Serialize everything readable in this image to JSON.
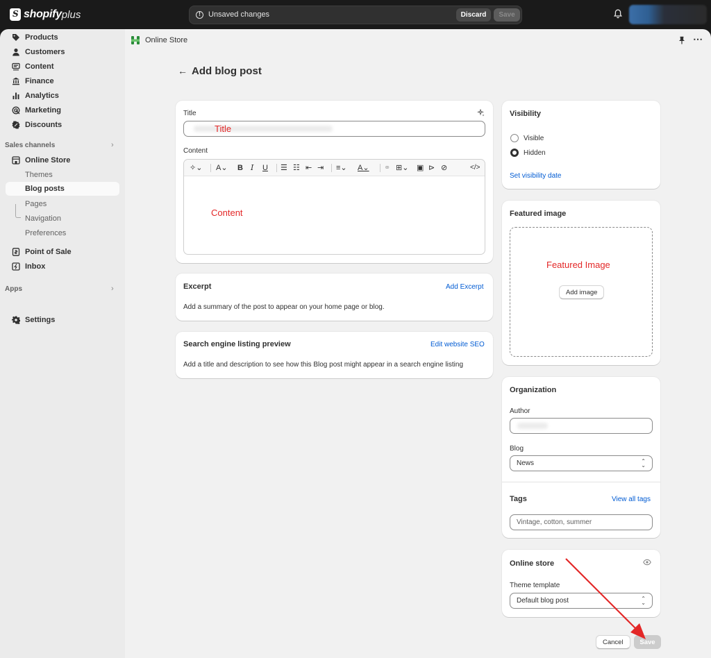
{
  "topbar": {
    "logo_text": "shopify",
    "logo_plus": "plus",
    "unsaved_text": "Unsaved changes",
    "discard_label": "Discard",
    "save_label": "Save"
  },
  "sidebar": {
    "items": [
      {
        "label": "Products",
        "icon": "tag-icon"
      },
      {
        "label": "Customers",
        "icon": "person-icon"
      },
      {
        "label": "Content",
        "icon": "content-icon"
      },
      {
        "label": "Finance",
        "icon": "bank-icon"
      },
      {
        "label": "Analytics",
        "icon": "bar-chart-icon"
      },
      {
        "label": "Marketing",
        "icon": "target-icon"
      },
      {
        "label": "Discounts",
        "icon": "discount-icon"
      }
    ],
    "sales_channels_label": "Sales channels",
    "online_store_label": "Online Store",
    "online_store_sub": [
      "Themes",
      "Blog posts",
      "Pages",
      "Navigation",
      "Preferences"
    ],
    "pos_label": "Point of Sale",
    "inbox_label": "Inbox",
    "apps_label": "Apps",
    "settings_label": "Settings"
  },
  "header": {
    "breadcrumb": "Online Store",
    "page_title": "Add blog post"
  },
  "post_card": {
    "title_label": "Title",
    "title_annotation": "Title",
    "content_label": "Content",
    "content_annotation": "Content"
  },
  "excerpt_card": {
    "heading": "Excerpt",
    "link": "Add Excerpt",
    "description": "Add a summary of the post to appear on your home page or blog."
  },
  "seo_card": {
    "heading": "Search engine listing preview",
    "link": "Edit website SEO",
    "description": "Add a title and description to see how this Blog post might appear in a search engine listing"
  },
  "visibility_card": {
    "heading": "Visibility",
    "options": [
      "Visible",
      "Hidden"
    ],
    "selected": "Hidden",
    "link": "Set visibility date"
  },
  "featured_card": {
    "heading": "Featured image",
    "annotation": "Featured Image",
    "button": "Add image"
  },
  "organization_card": {
    "heading": "Organization",
    "author_label": "Author",
    "blog_label": "Blog",
    "blog_value": "News",
    "tags_label": "Tags",
    "tags_link": "View all tags",
    "tags_placeholder": "Vintage, cotton, summer"
  },
  "online_store_card": {
    "heading": "Online store",
    "template_label": "Theme template",
    "template_value": "Default blog post"
  },
  "footer": {
    "cancel_label": "Cancel",
    "save_label": "Save"
  },
  "colors": {
    "accent_link": "#005bd3",
    "annotation_red": "#e32727",
    "topbar_bg": "#1a1a1a"
  }
}
